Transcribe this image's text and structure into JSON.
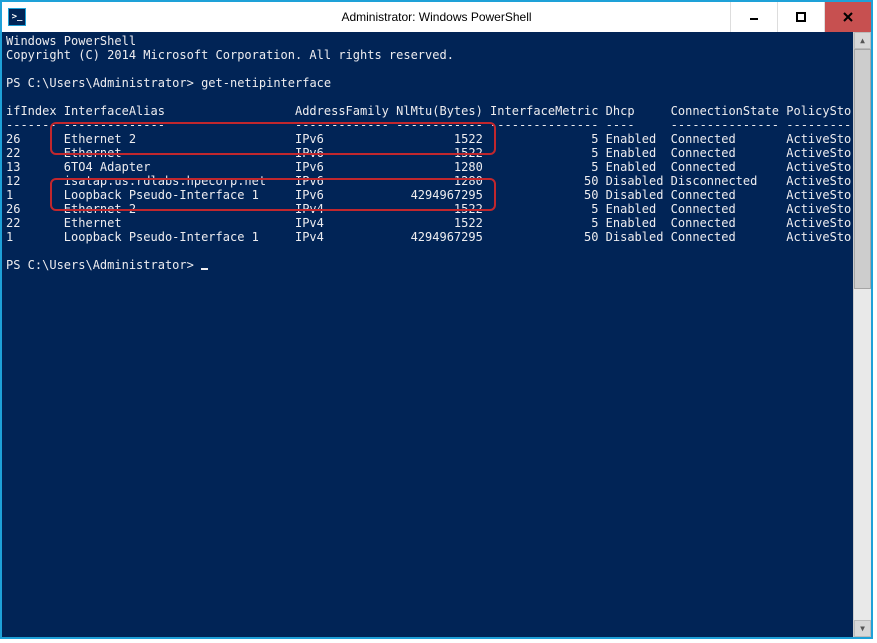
{
  "window": {
    "title": "Administrator: Windows PowerShell",
    "icon_label": ">_"
  },
  "header": {
    "line1": "Windows PowerShell",
    "line2": "Copyright (C) 2014 Microsoft Corporation. All rights reserved."
  },
  "prompt1": {
    "path": "PS C:\\Users\\Administrator>",
    "command": "get-netipinterface"
  },
  "columns": {
    "c1": "ifIndex",
    "c2": "InterfaceAlias",
    "c3": "AddressFamily",
    "c4": "NlMtu(Bytes)",
    "c5": "InterfaceMetric",
    "c6": "Dhcp",
    "c7": "ConnectionState",
    "c8": "PolicyStore"
  },
  "rows": [
    {
      "ifIndex": "26",
      "alias": "Ethernet 2",
      "family": "IPv6",
      "mtu": "1522",
      "metric": "5",
      "dhcp": "Enabled",
      "conn": "Connected",
      "policy": "ActiveStore"
    },
    {
      "ifIndex": "22",
      "alias": "Ethernet",
      "family": "IPv6",
      "mtu": "1522",
      "metric": "5",
      "dhcp": "Enabled",
      "conn": "Connected",
      "policy": "ActiveStore"
    },
    {
      "ifIndex": "13",
      "alias": "6TO4 Adapter",
      "family": "IPv6",
      "mtu": "1280",
      "metric": "5",
      "dhcp": "Enabled",
      "conn": "Connected",
      "policy": "ActiveStore"
    },
    {
      "ifIndex": "12",
      "alias": "isatap.us.rdlabs.hpecorp.net",
      "family": "IPv6",
      "mtu": "1280",
      "metric": "50",
      "dhcp": "Disabled",
      "conn": "Disconnected",
      "policy": "ActiveStore"
    },
    {
      "ifIndex": "1",
      "alias": "Loopback Pseudo-Interface 1",
      "family": "IPv6",
      "mtu": "4294967295",
      "metric": "50",
      "dhcp": "Disabled",
      "conn": "Connected",
      "policy": "ActiveStore"
    },
    {
      "ifIndex": "26",
      "alias": "Ethernet 2",
      "family": "IPv4",
      "mtu": "1522",
      "metric": "5",
      "dhcp": "Enabled",
      "conn": "Connected",
      "policy": "ActiveStore"
    },
    {
      "ifIndex": "22",
      "alias": "Ethernet",
      "family": "IPv4",
      "mtu": "1522",
      "metric": "5",
      "dhcp": "Enabled",
      "conn": "Connected",
      "policy": "ActiveStore"
    },
    {
      "ifIndex": "1",
      "alias": "Loopback Pseudo-Interface 1",
      "family": "IPv4",
      "mtu": "4294967295",
      "metric": "50",
      "dhcp": "Disabled",
      "conn": "Connected",
      "policy": "ActiveStore"
    }
  ],
  "prompt2": {
    "path": "PS C:\\Users\\Administrator>"
  }
}
